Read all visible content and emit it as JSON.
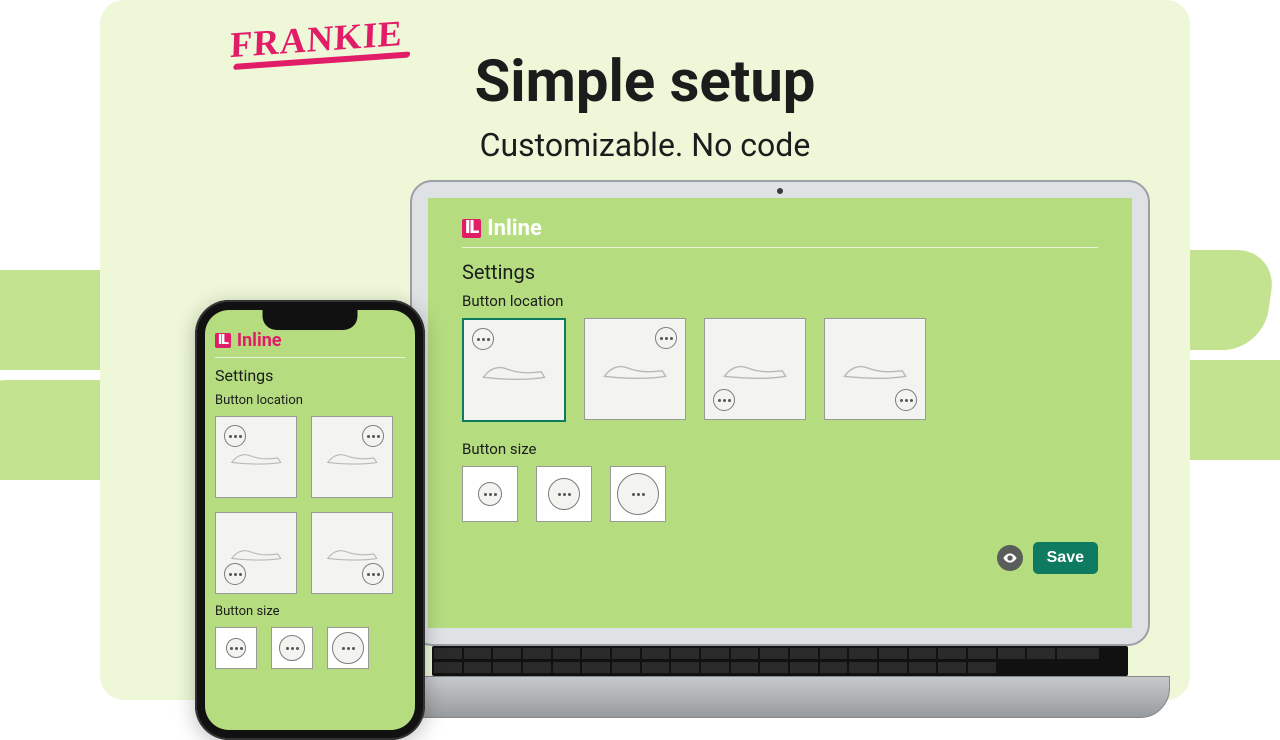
{
  "brand": "FRANKIE",
  "hero": {
    "title": "Simple setup",
    "subtitle": "Customizable. No code"
  },
  "panel": {
    "badge": "IL",
    "title": "Inline",
    "settings_heading": "Settings",
    "button_location_label": "Button location",
    "button_size_label": "Button size",
    "locations": [
      "top-left",
      "top-right",
      "bottom-left",
      "bottom-right"
    ],
    "selected_location": "top-left",
    "sizes": [
      "small",
      "medium",
      "large"
    ],
    "selected_size": "small"
  },
  "actions": {
    "preview_icon": "eye-icon",
    "save_label": "Save"
  }
}
